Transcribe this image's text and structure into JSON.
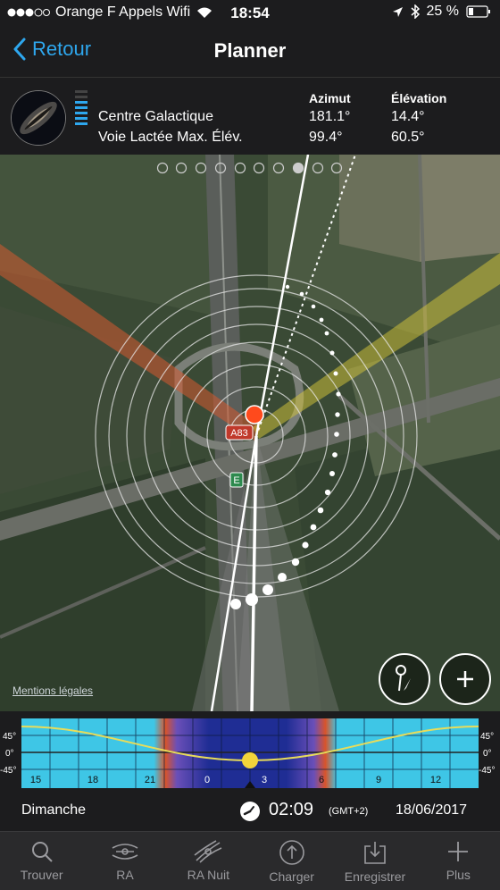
{
  "status": {
    "carrier": "Orange F Appels Wifi",
    "time": "18:54",
    "battery": "25 %"
  },
  "nav": {
    "back_label": "Retour",
    "title": "Planner"
  },
  "info": {
    "col_azimuth": "Azimut",
    "col_elevation": "Élévation",
    "rows": [
      {
        "name": "Centre Galactique",
        "azimuth": "181.1°",
        "elevation": "14.4°"
      },
      {
        "name": "Voie Lactée Max. Élév.",
        "azimuth": "99.4°",
        "elevation": "60.5°"
      }
    ]
  },
  "map": {
    "road_label": "A83",
    "exit_label": "E",
    "legal": "Mentions légales",
    "page_dots": 10,
    "active_page": 7
  },
  "timeline": {
    "y_labels": [
      "45°",
      "0°",
      "-45°"
    ],
    "hours": [
      "15",
      "18",
      "21",
      "0",
      "3",
      "6",
      "9",
      "12"
    ]
  },
  "footer": {
    "day": "Dimanche",
    "time": "02:09",
    "tz": "(GMT+2)",
    "date": "18/06/2017"
  },
  "tabs": [
    {
      "label": "Trouver",
      "icon": "search-icon"
    },
    {
      "label": "RA",
      "icon": "ra-icon"
    },
    {
      "label": "RA Nuit",
      "icon": "ra-night-icon"
    },
    {
      "label": "Charger",
      "icon": "upload-icon"
    },
    {
      "label": "Enregistrer",
      "icon": "save-icon"
    },
    {
      "label": "Plus",
      "icon": "plus-icon"
    }
  ],
  "colors": {
    "accent": "#2ea7ee",
    "sun_orange": "#ff4a1c",
    "sunset_band": "#e0562a",
    "sunrise_band": "#d6c23a"
  }
}
